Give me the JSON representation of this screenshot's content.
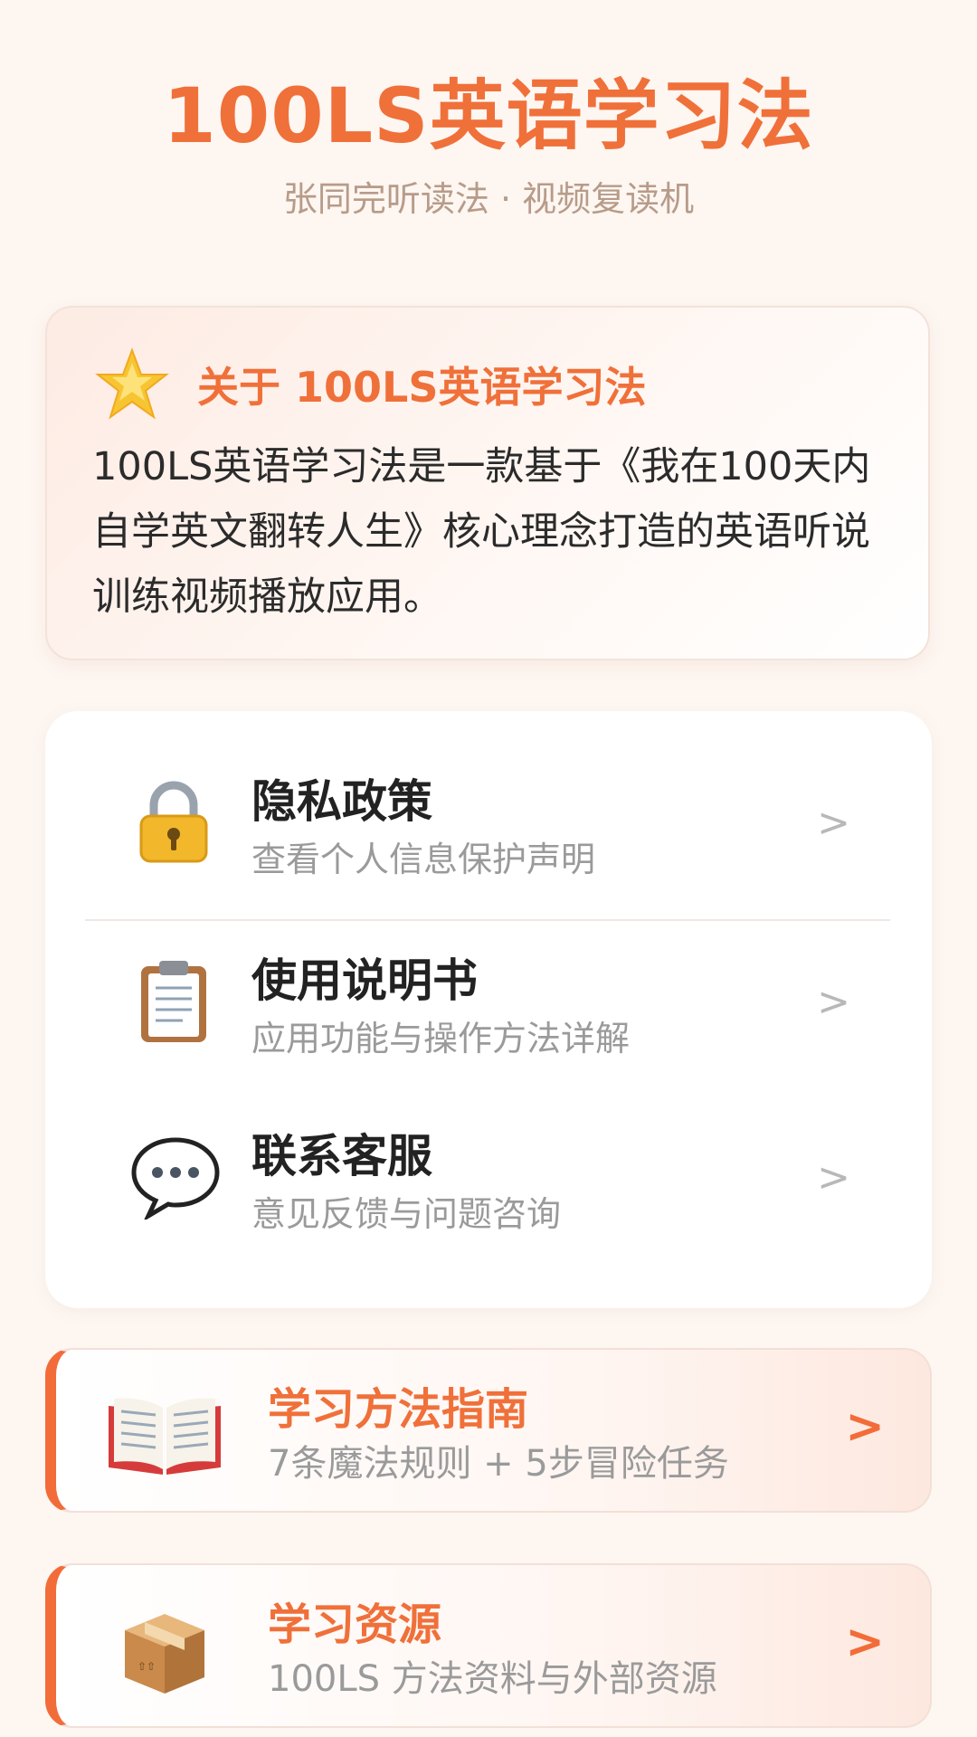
{
  "header": {
    "title": "100LS英语学习法",
    "subtitle": "张同完听读法 · 视频复读机"
  },
  "about": {
    "icon": "star-icon",
    "title": "关于 100LS英语学习法",
    "text": "100LS英语学习法是一款基于《我在100天内自学英文翻转人生》核心理念打造的英语听说训练视频播放应用。"
  },
  "menu": {
    "items": [
      {
        "icon": "lock-icon",
        "title": "隐私政策",
        "subtitle": "查看个人信息保护声明",
        "chevron": ">"
      },
      {
        "icon": "clipboard-icon",
        "title": "使用说明书",
        "subtitle": "应用功能与操作方法详解",
        "chevron": ">"
      },
      {
        "icon": "speech-bubble-icon",
        "title": "联系客服",
        "subtitle": "意见反馈与问题咨询",
        "chevron": ">"
      }
    ]
  },
  "features": [
    {
      "icon": "open-book-icon",
      "title": "学习方法指南",
      "subtitle": "7条魔法规则 + 5步冒险任务",
      "chevron": ">"
    },
    {
      "icon": "package-icon",
      "title": "学习资源",
      "subtitle": "100LS 方法资料与外部资源",
      "chevron": ">"
    }
  ],
  "colors": {
    "accent": "#f0703a",
    "background": "#fdf6f1"
  }
}
